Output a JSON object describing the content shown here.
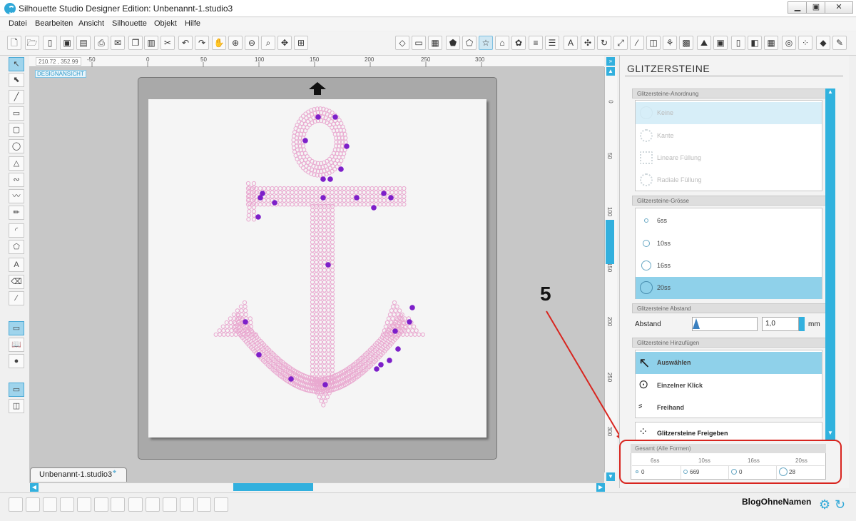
{
  "window": {
    "title": "Silhouette Studio Designer Edition: Unbenannt-1.studio3"
  },
  "menu": [
    "Datei",
    "Bearbeiten",
    "Ansicht",
    "Silhouette",
    "Objekt",
    "Hilfe"
  ],
  "canvas": {
    "coords": "210.72 , 352.99",
    "view_label": "DESIGNANSICHT",
    "ruler_top": [
      "-50",
      "0",
      "50",
      "100",
      "150",
      "200",
      "250",
      "300"
    ],
    "ruler_right": [
      "0",
      "50",
      "100",
      "150",
      "200",
      "250",
      "300"
    ],
    "tab_label": "Unbenannt-1.studio3"
  },
  "panel": {
    "title": "GLITZERSTEINE",
    "arrangement": {
      "header": "Glitzersteine-Anordnung",
      "options": [
        "Keine",
        "Kante",
        "Lineare Füllung",
        "Radiale Füllung"
      ],
      "selected": "Keine"
    },
    "size": {
      "header": "Glitzersteine-Grösse",
      "options": [
        "6ss",
        "10ss",
        "16ss",
        "20ss"
      ],
      "selected": "20ss"
    },
    "spacing": {
      "header": "Glitzersteine Abstand",
      "label": "Abstand",
      "value": "1,0",
      "unit": "mm"
    },
    "add": {
      "header": "Glitzersteine Hinzufügen",
      "options": [
        "Auswählen",
        "Einzelner Klick",
        "Freihand"
      ],
      "selected": "Auswählen"
    },
    "release_label": "Glitzersteine Freigeben",
    "totals": {
      "header": "Gesamt (Alle Formen)",
      "columns": [
        "6ss",
        "10ss",
        "16ss",
        "20ss"
      ],
      "values": [
        "0",
        "669",
        "0",
        "28"
      ]
    }
  },
  "annotation": {
    "label": "5",
    "color": "#d8251f"
  },
  "brand": "BlogOhneNamen",
  "colors": {
    "accent": "#32b0de",
    "rhinestone": "#e9a9d0",
    "dot": "#7d1fc9"
  }
}
